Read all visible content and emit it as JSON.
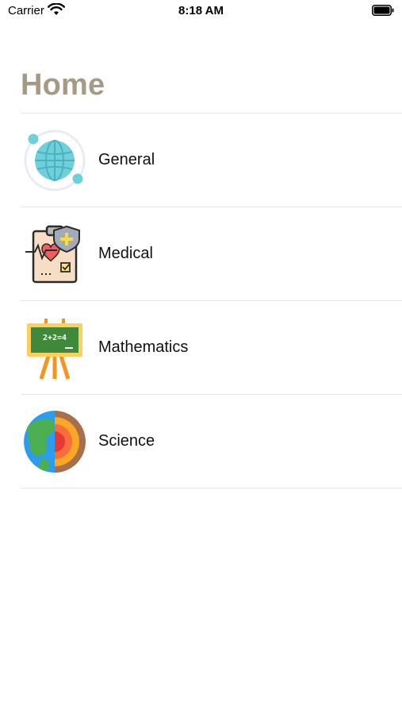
{
  "status_bar": {
    "carrier": "Carrier",
    "time": "8:18 AM"
  },
  "header": {
    "title": "Home",
    "title_color": "#a69a85"
  },
  "categories": [
    {
      "label": "General",
      "icon": "globe-icon"
    },
    {
      "label": "Medical",
      "icon": "medical-clipboard-icon"
    },
    {
      "label": "Mathematics",
      "icon": "chalkboard-icon"
    },
    {
      "label": "Science",
      "icon": "earth-layers-icon"
    }
  ]
}
